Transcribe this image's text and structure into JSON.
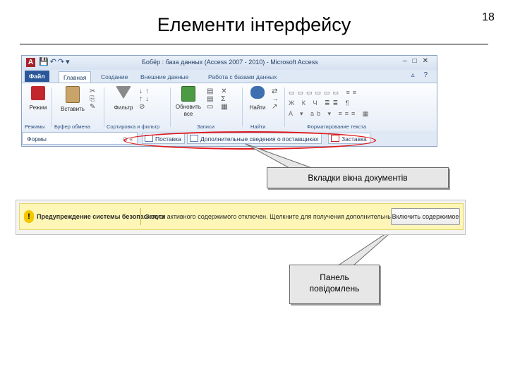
{
  "slide": {
    "title": "Елементи інтерфейсу",
    "page_number": "18"
  },
  "access_window": {
    "app_icon": "A",
    "title": "Бобёр : база данных (Access 2007 - 2010) - Microsoft Access",
    "tabs": [
      "Файл",
      "Главная",
      "Создание",
      "Внешние данные",
      "Работа с базами данных"
    ],
    "active_tab": "Главная",
    "ribbon_buttons": {
      "mode": "Режим",
      "paste": "Вставить",
      "filter": "Фильтр",
      "refresh": "Обновить все",
      "find": "Найти"
    },
    "group_labels": [
      "Режимы",
      "Буфер обмена",
      "Сортировка и фильтр",
      "Записи",
      "Найти",
      "Форматирование текста"
    ],
    "nav_pane": "Формы",
    "document_tabs": [
      "Поставка",
      "Дополнительные сведения о поставщиках",
      "Заставка"
    ]
  },
  "callouts": {
    "doc_tabs": "Вкладки вікна документів",
    "message_bar_line1": "Панель",
    "message_bar_line2": "повідомлень"
  },
  "message_bar": {
    "title": "Предупреждение системы безопасности",
    "text": "Запуск активного содержимого отключен. Щелкните для получения дополнительных сведений.",
    "button": "Включить содержимое"
  },
  "colors": {
    "oval": "#e0191d",
    "message_bar_bg": "#fdf6b6",
    "file_tab": "#2b579a"
  }
}
